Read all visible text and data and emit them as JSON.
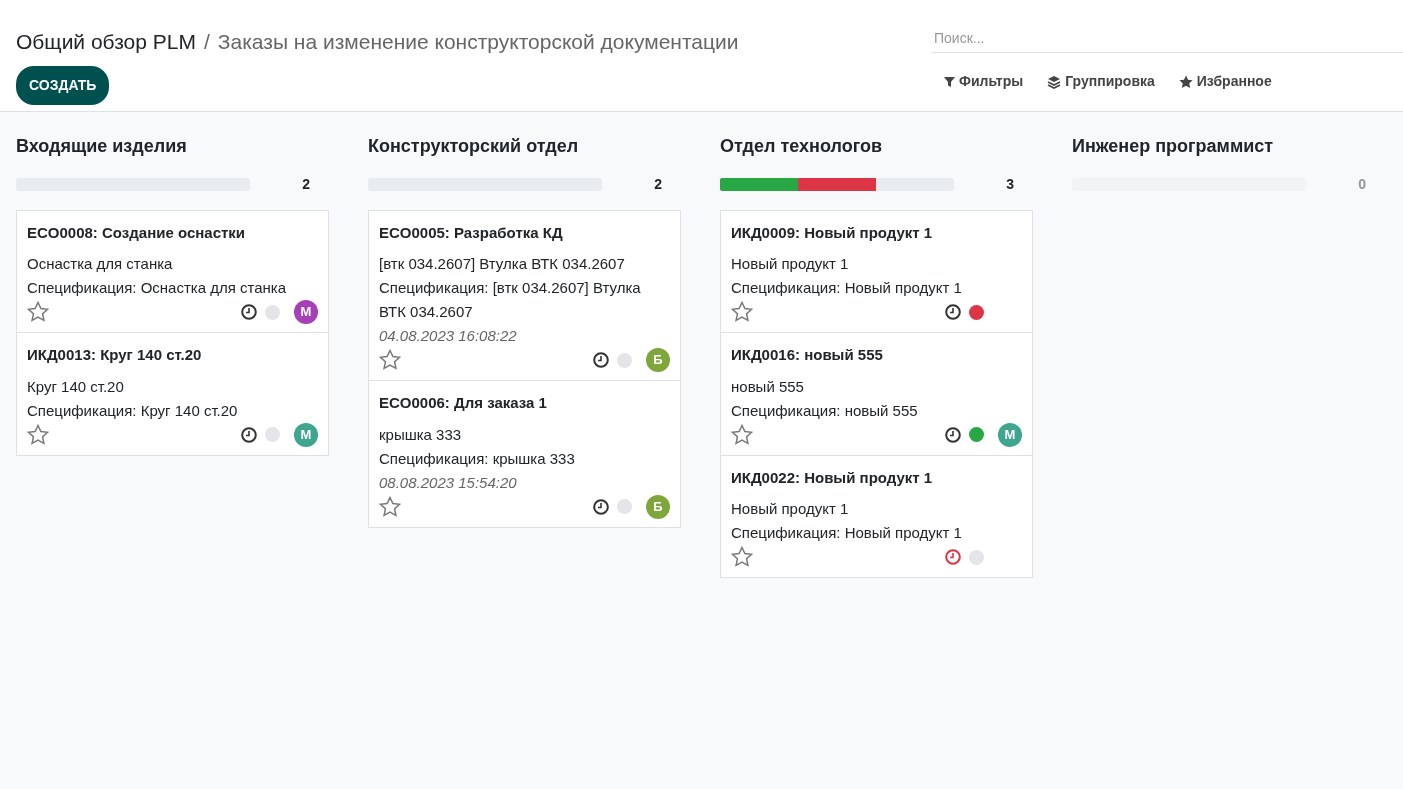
{
  "breadcrumb": {
    "root": "Общий обзор PLM",
    "separator": "/",
    "current": "Заказы на изменение конструкторской документации"
  },
  "create_button": "СОЗДАТЬ",
  "search": {
    "placeholder": "Поиск..."
  },
  "filters": [
    {
      "kind": "filter",
      "label": "Фильтры"
    },
    {
      "kind": "group",
      "label": "Группировка"
    },
    {
      "kind": "favorite",
      "label": "Избранное"
    }
  ],
  "columns": [
    {
      "title": "Входящие изделия",
      "count": "2",
      "cards": [
        {
          "title": "ECO0008: Создание оснастки",
          "lines": [
            "Оснастка для станка",
            "Спецификация: Оснастка для станка"
          ],
          "favorite": false,
          "activity_overdue": false,
          "status": {
            "color": "#e3e5e8"
          },
          "avatar": {
            "letter": "M",
            "color": "#a63fb8"
          }
        },
        {
          "title": "ИКД0013: Круг 140 ст.20",
          "lines": [
            "Круг 140 ст.20",
            "Спецификация: Круг 140 ст.20"
          ],
          "favorite": false,
          "activity_overdue": false,
          "status": {
            "color": "#e3e5e8"
          },
          "avatar": {
            "letter": "M",
            "color": "#3ea68f"
          }
        }
      ]
    },
    {
      "title": "Конструкторский отдел",
      "count": "2",
      "cards": [
        {
          "title": "ECO0005: Разработка КД",
          "lines": [
            "[втк 034.2607] Втулка ВТК 034.2607",
            "Спецификация: [втк 034.2607] Втулка ВТК 034.2607"
          ],
          "date": "04.08.2023 16:08:22",
          "favorite": false,
          "activity_overdue": false,
          "status": {
            "color": "#e3e5e8"
          },
          "avatar": {
            "letter": "Б",
            "color": "#7fa63a"
          }
        },
        {
          "title": "ECO0006: Для заказа 1",
          "lines": [
            "крышка 333",
            "Спецификация: крышка 333"
          ],
          "date": "08.08.2023 15:54:20",
          "favorite": false,
          "activity_overdue": false,
          "status": {
            "color": "#e3e5e8"
          },
          "avatar": {
            "letter": "Б",
            "color": "#7fa63a"
          }
        }
      ]
    },
    {
      "title": "Отдел технологов",
      "count": "3",
      "progress": [
        {
          "color": "#dc3545",
          "level": 0.667
        },
        {
          "color": "#28a745",
          "level": 0.333
        }
      ],
      "cards": [
        {
          "title": "ИКД0009: Новый продукт 1",
          "lines": [
            "Новый продукт 1",
            "Спецификация: Новый продукт 1"
          ],
          "favorite": false,
          "activity_overdue": false,
          "status": {
            "color": "#dc3545"
          }
        },
        {
          "title": "ИКД0016: новый 555",
          "lines": [
            "новый 555",
            "Спецификация: новый 555"
          ],
          "favorite": false,
          "activity_overdue": false,
          "status": {
            "color": "#28a745"
          },
          "avatar": {
            "letter": "M",
            "color": "#3ea68f"
          }
        },
        {
          "title": "ИКД0022: Новый продукт 1",
          "lines": [
            "Новый продукт 1",
            "Спецификация: Новый продукт 1"
          ],
          "favorite": false,
          "activity_overdue": true,
          "status": {
            "color": "#e3e5e8"
          }
        }
      ]
    },
    {
      "title": "Инженер программист",
      "count": "0"
    }
  ]
}
